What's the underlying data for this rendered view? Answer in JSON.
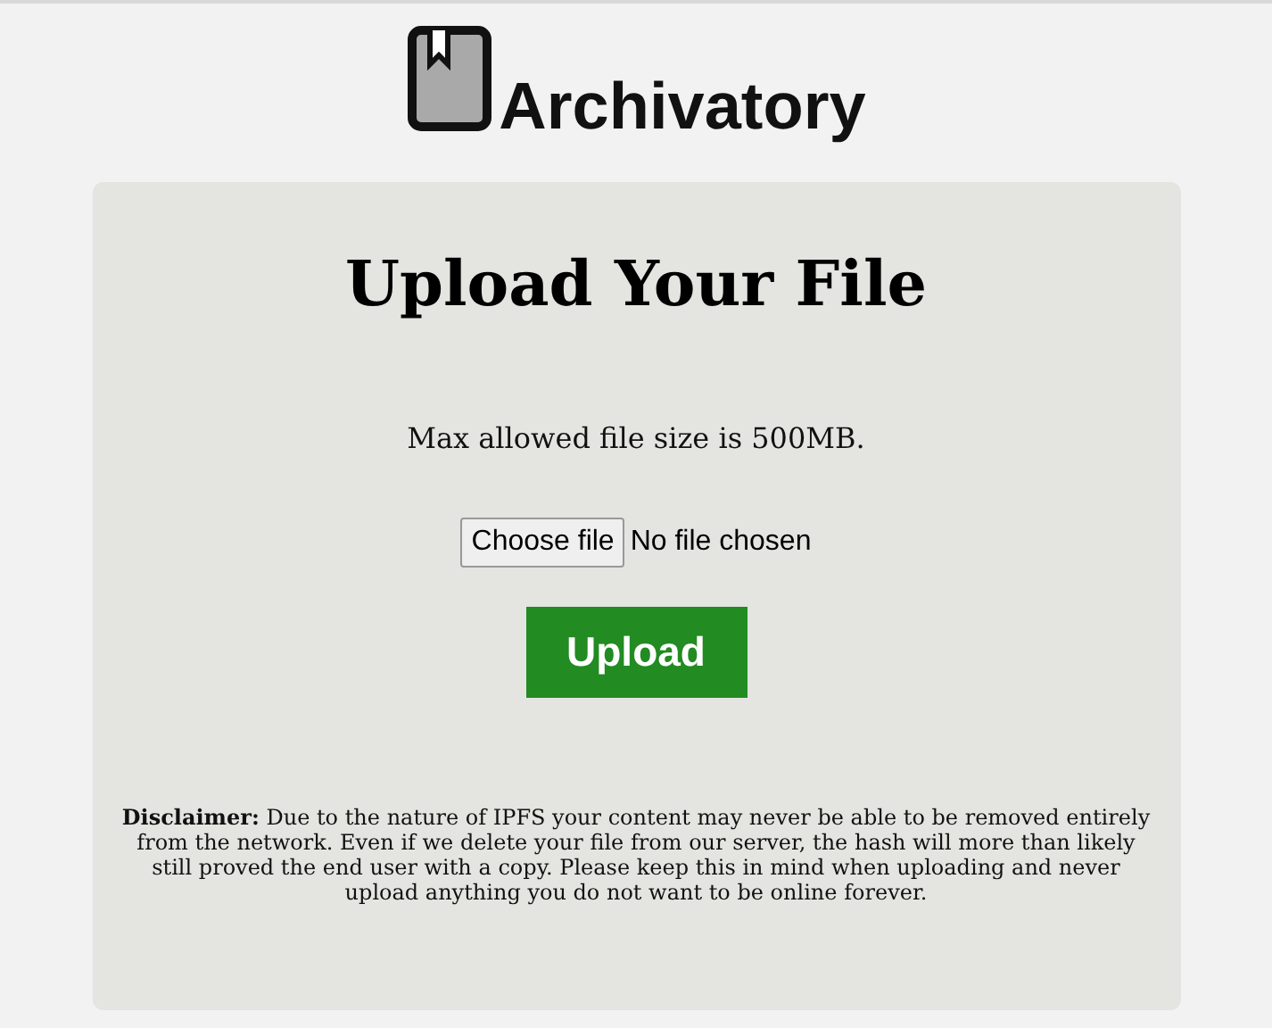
{
  "logo": {
    "text": "Archivatory"
  },
  "card": {
    "title": "Upload Your File",
    "size_note": "Max allowed file size is 500MB.",
    "file_input": {
      "button": "Choose file",
      "status": "No file chosen"
    },
    "upload_button": "Upload",
    "disclaimer": "**Disclaimer:** Due to the nature of IPFS your content may never be able to be removed entirely from the network. Even if we delete your file from our server, the hash will more than likely still proved the end user with a copy. Please keep this in mind when uploading and never upload anything you do not want to be online forever."
  }
}
